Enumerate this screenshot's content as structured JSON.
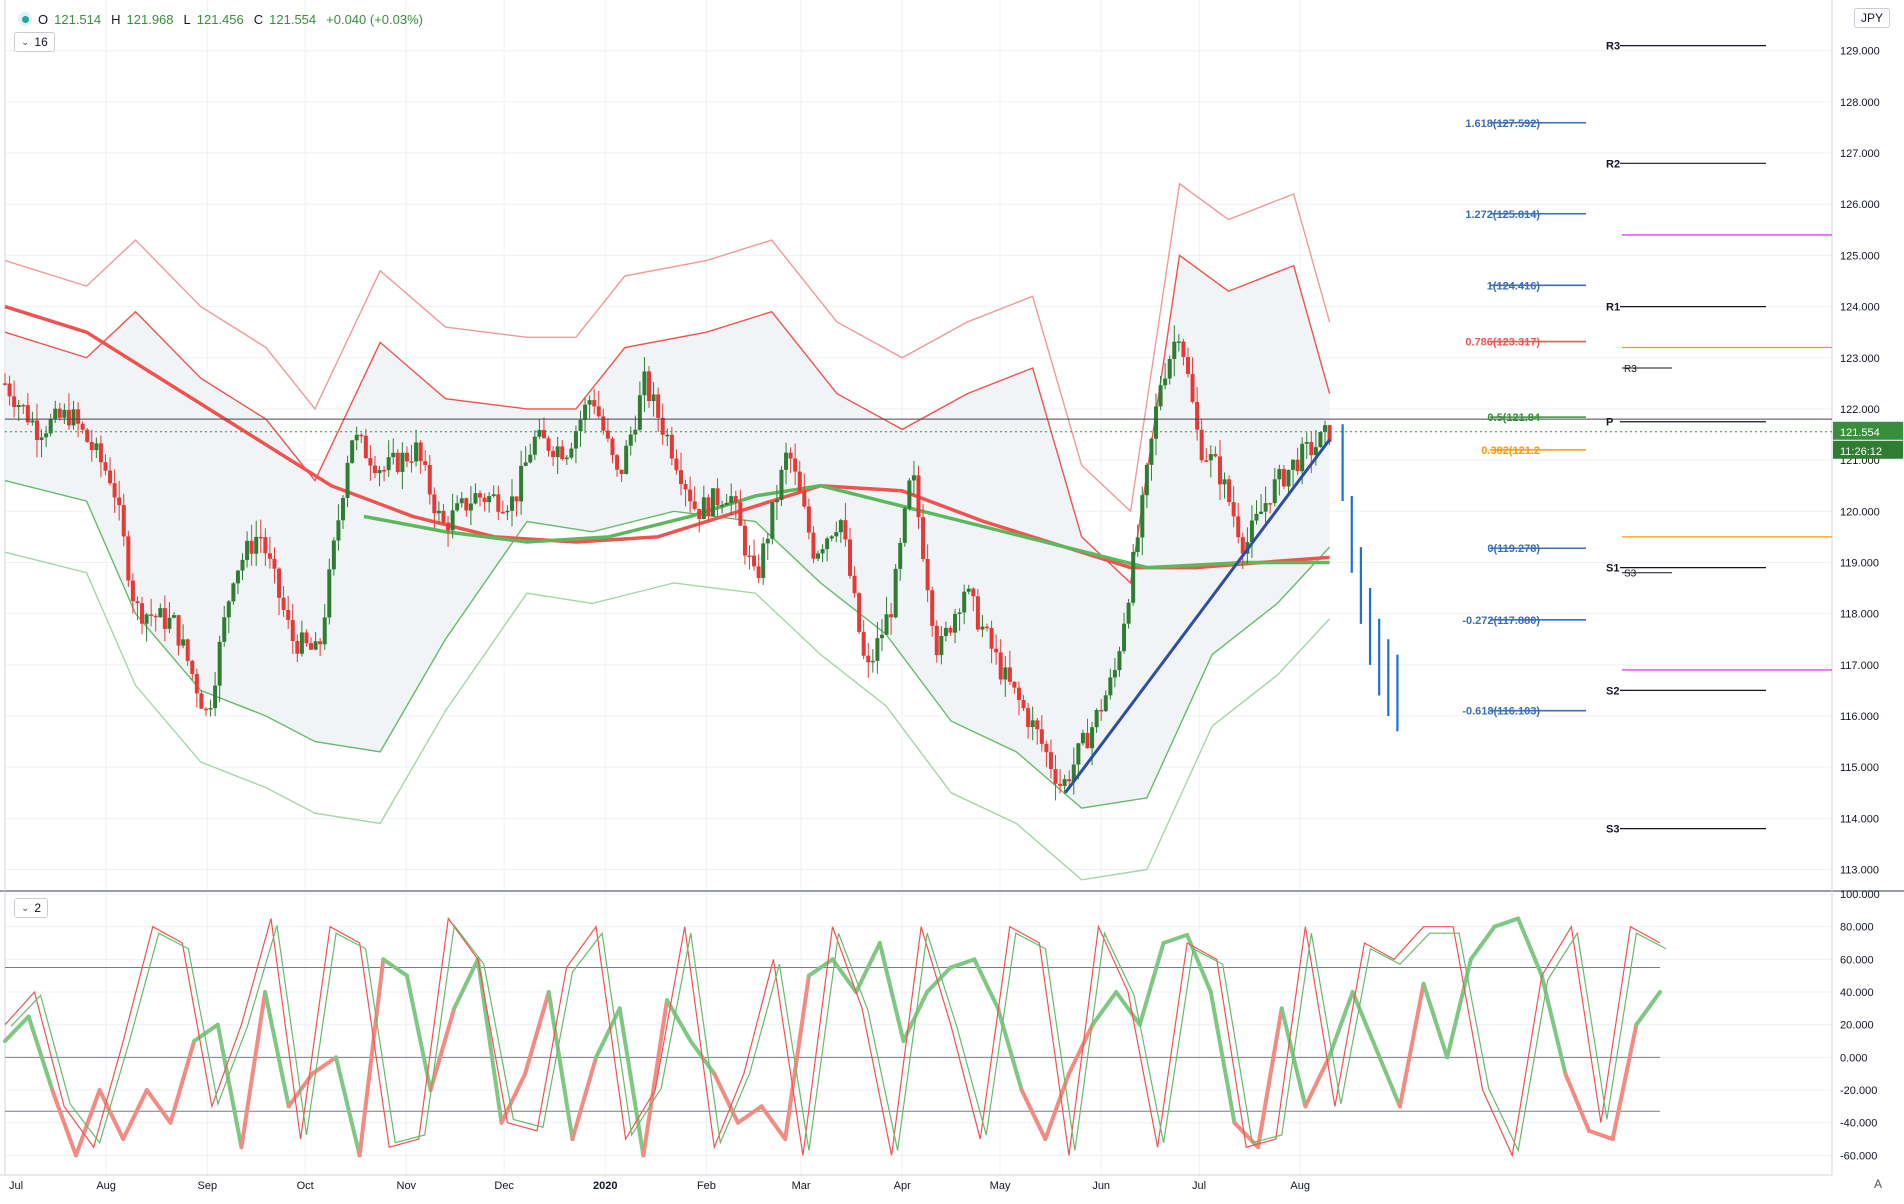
{
  "legend": {
    "symbol_icon": "instrument-dot-icon",
    "open_label": "O",
    "open": "121.514",
    "high_label": "H",
    "high": "121.968",
    "low_label": "L",
    "low": "121.456",
    "close_label": "C",
    "close": "121.554",
    "change": "+0.040 (+0.03%)"
  },
  "panes": {
    "main_count": "16",
    "osc_count": "2"
  },
  "currency": "JPY",
  "price_tag": {
    "price": "121.554",
    "countdown": "11:26:12"
  },
  "bottom_right_label": "A",
  "chart_data": [
    {
      "type": "candlestick",
      "quote_currency": "JPY",
      "y_ticks": [
        113.0,
        114.0,
        115.0,
        116.0,
        117.0,
        118.0,
        119.0,
        120.0,
        121.0,
        122.0,
        123.0,
        124.0,
        125.0,
        126.0,
        127.0,
        128.0,
        129.0
      ],
      "ylim": [
        112.6,
        129.6
      ],
      "x_ticks": [
        "Jul",
        "Aug",
        "Sep",
        "Oct",
        "Nov",
        "Dec",
        "2020",
        "Feb",
        "Mar",
        "Apr",
        "May",
        "Jun",
        "Jul",
        "Aug"
      ],
      "current_price": 121.554,
      "ohlc_segments": [
        {
          "d": 0,
          "p": 122.5
        },
        {
          "d": 10,
          "p": 121.6
        },
        {
          "d": 20,
          "p": 121.9
        },
        {
          "d": 33,
          "p": 120.6
        },
        {
          "d": 40,
          "p": 118.1
        },
        {
          "d": 52,
          "p": 117.8
        },
        {
          "d": 62,
          "p": 116.0
        },
        {
          "d": 70,
          "p": 118.8
        },
        {
          "d": 78,
          "p": 119.6
        },
        {
          "d": 88,
          "p": 117.5
        },
        {
          "d": 96,
          "p": 117.2
        },
        {
          "d": 106,
          "p": 121.5
        },
        {
          "d": 116,
          "p": 120.8
        },
        {
          "d": 126,
          "p": 121.2
        },
        {
          "d": 134,
          "p": 119.7
        },
        {
          "d": 144,
          "p": 120.3
        },
        {
          "d": 156,
          "p": 120.2
        },
        {
          "d": 162,
          "p": 121.4
        },
        {
          "d": 172,
          "p": 121.2
        },
        {
          "d": 180,
          "p": 122.3
        },
        {
          "d": 188,
          "p": 120.6
        },
        {
          "d": 196,
          "p": 122.5
        },
        {
          "d": 204,
          "p": 121.3
        },
        {
          "d": 212,
          "p": 120.0
        },
        {
          "d": 222,
          "p": 120.4
        },
        {
          "d": 230,
          "p": 118.6
        },
        {
          "d": 240,
          "p": 121.2
        },
        {
          "d": 248,
          "p": 119.2
        },
        {
          "d": 256,
          "p": 119.9
        },
        {
          "d": 264,
          "p": 116.8
        },
        {
          "d": 272,
          "p": 118.2
        },
        {
          "d": 278,
          "p": 120.8
        },
        {
          "d": 286,
          "p": 117.2
        },
        {
          "d": 294,
          "p": 118.5
        },
        {
          "d": 306,
          "p": 116.8
        },
        {
          "d": 316,
          "p": 115.7
        },
        {
          "d": 324,
          "p": 114.6
        },
        {
          "d": 334,
          "p": 115.9
        },
        {
          "d": 340,
          "p": 116.8
        },
        {
          "d": 348,
          "p": 119.8
        },
        {
          "d": 354,
          "p": 122.5
        },
        {
          "d": 360,
          "p": 123.6
        },
        {
          "d": 366,
          "p": 121.3
        },
        {
          "d": 372,
          "p": 120.8
        },
        {
          "d": 380,
          "p": 119.3
        },
        {
          "d": 388,
          "p": 120.4
        },
        {
          "d": 396,
          "p": 121.0
        },
        {
          "d": 402,
          "p": 121.3
        },
        {
          "d": 406,
          "p": 121.554
        }
      ],
      "moving_average_slow": [
        {
          "d": 0,
          "p": 124.0
        },
        {
          "d": 25,
          "p": 123.5
        },
        {
          "d": 50,
          "p": 122.5
        },
        {
          "d": 75,
          "p": 121.5
        },
        {
          "d": 100,
          "p": 120.5
        },
        {
          "d": 125,
          "p": 119.9
        },
        {
          "d": 150,
          "p": 119.5
        },
        {
          "d": 175,
          "p": 119.4
        },
        {
          "d": 200,
          "p": 119.5
        },
        {
          "d": 225,
          "p": 120.0
        },
        {
          "d": 250,
          "p": 120.5
        },
        {
          "d": 275,
          "p": 120.4
        },
        {
          "d": 300,
          "p": 119.8
        },
        {
          "d": 325,
          "p": 119.3
        },
        {
          "d": 345,
          "p": 118.9
        },
        {
          "d": 365,
          "p": 118.9
        },
        {
          "d": 385,
          "p": 119.0
        },
        {
          "d": 406,
          "p": 119.1
        }
      ],
      "moving_average_long": [
        {
          "d": 110,
          "p": 119.9
        },
        {
          "d": 135,
          "p": 119.6
        },
        {
          "d": 160,
          "p": 119.4
        },
        {
          "d": 185,
          "p": 119.5
        },
        {
          "d": 210,
          "p": 119.9
        },
        {
          "d": 230,
          "p": 120.3
        },
        {
          "d": 250,
          "p": 120.5
        },
        {
          "d": 350,
          "p": 118.9
        },
        {
          "d": 380,
          "p": 119.0
        },
        {
          "d": 406,
          "p": 119.0
        }
      ],
      "bollinger_upper": [
        {
          "d": 0,
          "p": 123.5
        },
        {
          "d": 25,
          "p": 123.0
        },
        {
          "d": 40,
          "p": 123.9
        },
        {
          "d": 60,
          "p": 122.6
        },
        {
          "d": 80,
          "p": 121.8
        },
        {
          "d": 95,
          "p": 120.6
        },
        {
          "d": 115,
          "p": 123.3
        },
        {
          "d": 135,
          "p": 122.2
        },
        {
          "d": 160,
          "p": 122.0
        },
        {
          "d": 175,
          "p": 122.0
        },
        {
          "d": 190,
          "p": 123.2
        },
        {
          "d": 215,
          "p": 123.5
        },
        {
          "d": 235,
          "p": 123.9
        },
        {
          "d": 255,
          "p": 122.3
        },
        {
          "d": 275,
          "p": 121.6
        },
        {
          "d": 295,
          "p": 122.3
        },
        {
          "d": 315,
          "p": 122.8
        },
        {
          "d": 330,
          "p": 119.5
        },
        {
          "d": 345,
          "p": 118.6
        },
        {
          "d": 360,
          "p": 125.0
        },
        {
          "d": 375,
          "p": 124.3
        },
        {
          "d": 395,
          "p": 124.8
        },
        {
          "d": 406,
          "p": 122.3
        }
      ],
      "bollinger_lower": [
        {
          "d": 0,
          "p": 120.6
        },
        {
          "d": 25,
          "p": 120.2
        },
        {
          "d": 40,
          "p": 118.0
        },
        {
          "d": 60,
          "p": 116.5
        },
        {
          "d": 80,
          "p": 116.0
        },
        {
          "d": 95,
          "p": 115.5
        },
        {
          "d": 115,
          "p": 115.3
        },
        {
          "d": 135,
          "p": 117.5
        },
        {
          "d": 160,
          "p": 119.8
        },
        {
          "d": 180,
          "p": 119.6
        },
        {
          "d": 205,
          "p": 120.0
        },
        {
          "d": 230,
          "p": 119.8
        },
        {
          "d": 250,
          "p": 118.6
        },
        {
          "d": 270,
          "p": 117.6
        },
        {
          "d": 290,
          "p": 115.9
        },
        {
          "d": 310,
          "p": 115.3
        },
        {
          "d": 330,
          "p": 114.2
        },
        {
          "d": 350,
          "p": 114.4
        },
        {
          "d": 370,
          "p": 117.2
        },
        {
          "d": 390,
          "p": 118.2
        },
        {
          "d": 406,
          "p": 119.3
        }
      ],
      "trendline": {
        "from": {
          "d": 325,
          "p": 114.5
        },
        "to": {
          "d": 406,
          "p": 121.4
        }
      },
      "horizontal_levels": [
        {
          "name": "P",
          "price": 121.8
        },
        {
          "name": "current",
          "price": 121.554
        }
      ],
      "fibonacci_levels": [
        {
          "label": "1.618(127.592)",
          "price": 127.592,
          "color": "#3c6eb4"
        },
        {
          "label": "1.272(125.814)",
          "price": 125.814,
          "color": "#3c6eb4"
        },
        {
          "label": "1(124.416)",
          "price": 124.416,
          "color": "#3c6eb4"
        },
        {
          "label": "0.786(123.317)",
          "price": 123.317,
          "color": "#ef5350"
        },
        {
          "label": "0.5(121.84",
          "price": 121.84,
          "color": "#388e3c"
        },
        {
          "label": "0.382(121.2",
          "price": 121.2,
          "color": "#ff9800"
        },
        {
          "label": "0(119.278)",
          "price": 119.278,
          "color": "#3c6eb4"
        },
        {
          "label": "-0.272(117.880)",
          "price": 117.88,
          "color": "#3c6eb4"
        },
        {
          "label": "-0.618(116.103)",
          "price": 116.103,
          "color": "#3c6eb4"
        }
      ],
      "pivot_levels": [
        {
          "label": "R3",
          "price": 129.1
        },
        {
          "label": "R2",
          "price": 126.8
        },
        {
          "label": "R1",
          "price": 124.0
        },
        {
          "label": "P",
          "price": 121.75
        },
        {
          "label": "S1",
          "price": 118.9
        },
        {
          "label": "S2",
          "price": 116.5
        },
        {
          "label": "S3",
          "price": 113.8
        }
      ],
      "minor_pivot_labels": [
        {
          "label": "R3",
          "price": 122.8
        },
        {
          "label": "S3",
          "price": 118.8
        }
      ],
      "extra_horizontal_levels": [
        {
          "price": 125.4,
          "color": "#e040fb"
        },
        {
          "price": 123.2,
          "color": "#ff9800"
        },
        {
          "price": 119.5,
          "color": "#ff9800"
        },
        {
          "price": 116.9,
          "color": "#e040fb"
        }
      ],
      "projection_path": [
        121.4,
        120.0,
        119.0,
        118.2,
        117.6,
        117.2,
        116.9
      ]
    },
    {
      "type": "line",
      "y_ticks": [
        -60.0,
        -40.0,
        -20.0,
        0.0,
        20.0,
        40.0,
        60.0,
        80.0,
        100.0
      ],
      "ylim": [
        -72,
        100
      ],
      "reference_lines": [
        55,
        0,
        -33
      ],
      "series": [
        {
          "values": [
            10,
            25,
            -20,
            -60,
            -20,
            -50,
            -20,
            -40,
            10,
            20,
            -55,
            40,
            -30,
            -10,
            0,
            -60,
            60,
            50,
            -20,
            30,
            60,
            -40,
            -10,
            40,
            -50,
            0,
            30,
            -60,
            35,
            10,
            -10,
            -40,
            -30,
            -50,
            50,
            60,
            40,
            70,
            10,
            40,
            55,
            60,
            30,
            -20,
            -50,
            -10,
            20,
            40,
            20,
            70,
            75,
            40,
            -40,
            -55,
            30,
            -30,
            0,
            40,
            5,
            -30,
            45,
            0,
            60,
            80,
            85,
            50,
            -10,
            -45,
            -50,
            20,
            40
          ]
        },
        {
          "values": [
            20,
            40,
            -30,
            -55,
            10,
            80,
            70,
            -30,
            20,
            85,
            -50,
            80,
            70,
            -55,
            -50,
            85,
            60,
            -40,
            -45,
            55,
            80,
            -50,
            -20,
            80,
            -55,
            -10,
            60,
            -60,
            80,
            30,
            -60,
            80,
            20,
            -50,
            80,
            70,
            -60,
            80,
            40,
            -55,
            70,
            60,
            -55,
            -50,
            80,
            -30,
            70,
            60,
            80,
            80,
            -20,
            -60,
            50,
            80,
            -40,
            80,
            70
          ]
        }
      ]
    }
  ]
}
